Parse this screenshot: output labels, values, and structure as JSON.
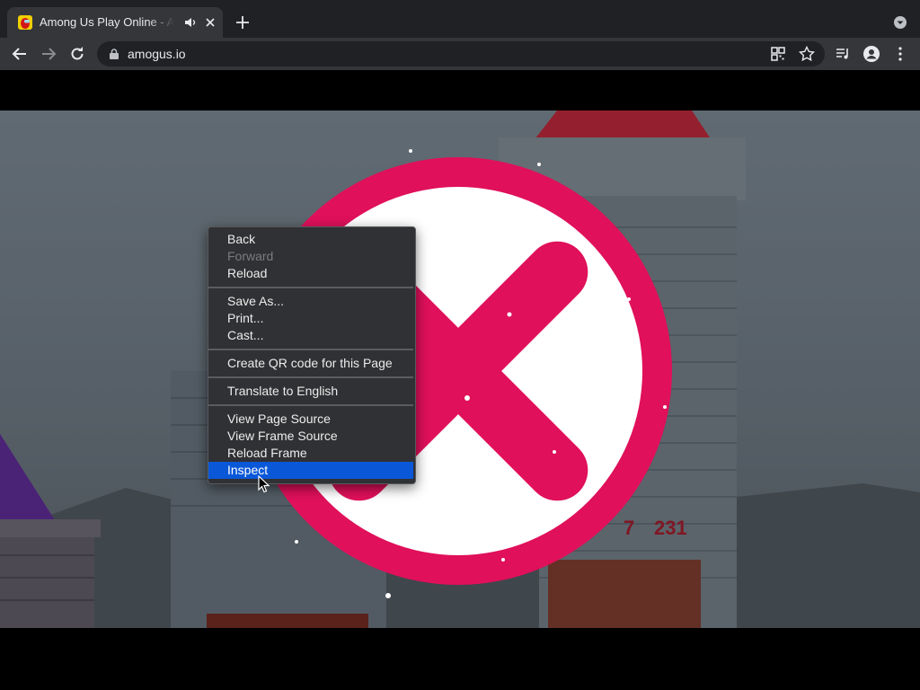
{
  "browser": {
    "tab": {
      "title": "Among Us Play Online - Among Us"
    },
    "address_bar": {
      "url": "amogus.io"
    },
    "icons": {
      "back": "back-arrow-icon",
      "forward": "forward-arrow-icon",
      "reload": "reload-icon",
      "lock": "lock-icon",
      "qr": "qr-code-icon",
      "bookmark": "star-icon",
      "media": "media-queue-icon",
      "profile": "profile-icon",
      "menu": "kebab-menu-icon"
    }
  },
  "game": {
    "score_text": "231",
    "partial_score": "7",
    "overlay_icon": "red-x-circle-icon"
  },
  "context_menu": {
    "items": [
      {
        "label": "Back"
      },
      {
        "label": "Forward",
        "disabled": true
      },
      {
        "label": "Reload"
      },
      {
        "label": "Save As..."
      },
      {
        "label": "Print..."
      },
      {
        "label": "Cast..."
      },
      {
        "label": "Create QR code for this Page"
      },
      {
        "label": "Translate to English"
      },
      {
        "label": "View Page Source"
      },
      {
        "label": "View Frame Source"
      },
      {
        "label": "Reload Frame"
      },
      {
        "label": "Inspect",
        "highlighted": true
      }
    ]
  },
  "colors": {
    "accent_highlight": "#0a58d8",
    "x_mark": "#e0105a"
  }
}
